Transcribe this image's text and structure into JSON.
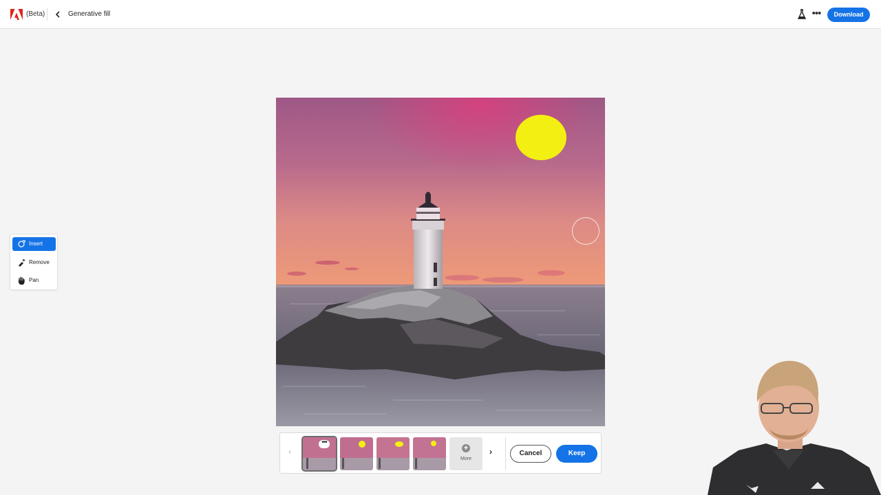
{
  "app": {
    "beta_label": "(Beta)",
    "page_title": "Generative fill"
  },
  "header": {
    "download_label": "Download",
    "more_glyph": "•••"
  },
  "tools": [
    {
      "label": "Insert",
      "icon": "insert-brush-icon",
      "active": true
    },
    {
      "label": "Remove",
      "icon": "remove-brush-icon",
      "active": false
    },
    {
      "label": "Pan",
      "icon": "hand-icon",
      "active": false
    }
  ],
  "variations": {
    "count": 4,
    "selected_index": 0,
    "thumb_more_glyph": "•••",
    "more_label": "More",
    "more_glyph": "+",
    "prev_glyph": "‹",
    "next_glyph": "›"
  },
  "actions": {
    "cancel_label": "Cancel",
    "keep_label": "Keep"
  },
  "colors": {
    "accent": "#1473e6",
    "sun": "#f4ef12",
    "sky_top": "#a05a8a",
    "sky_horizon": "#e9957a"
  },
  "icons": [
    "adobe-logo-icon",
    "chevron-left-icon",
    "flask-icon",
    "more-icon",
    "insert-brush-icon",
    "remove-brush-icon",
    "hand-icon",
    "chevron-right-icon",
    "plus-icon"
  ]
}
